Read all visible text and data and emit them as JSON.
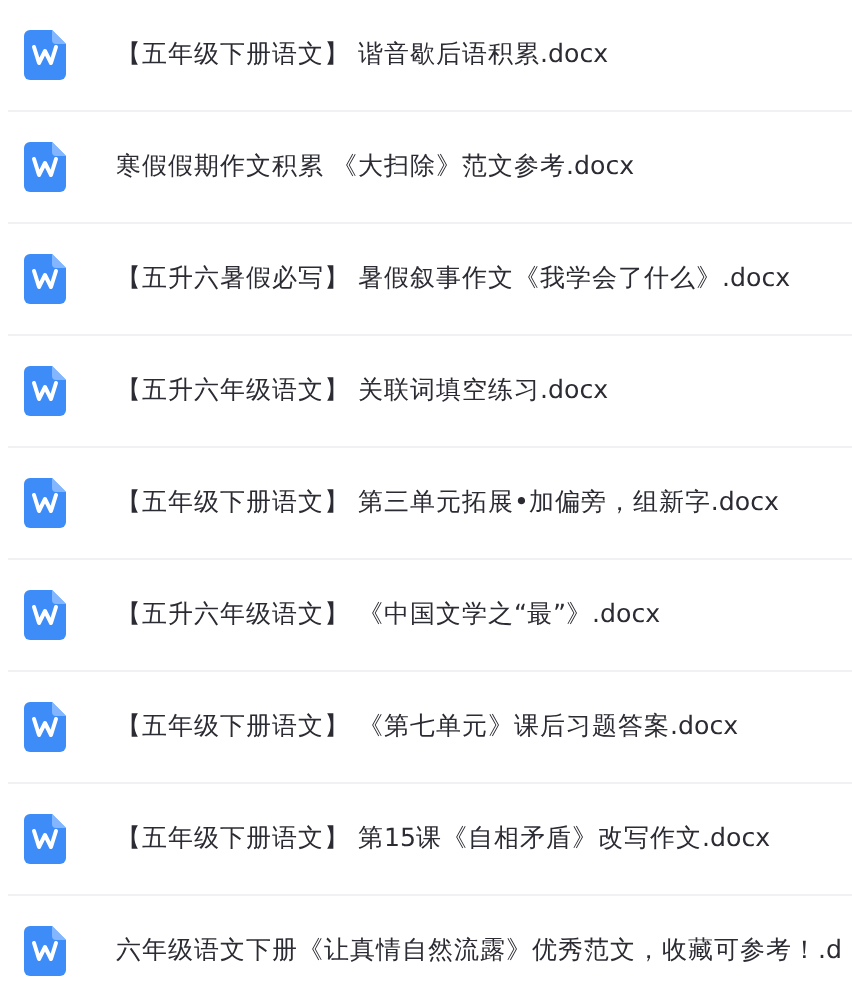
{
  "files": [
    {
      "name": "【五年级下册语文】 谐音歇后语积累.docx"
    },
    {
      "name": "寒假假期作文积累 《大扫除》范文参考.docx"
    },
    {
      "name": "【五升六暑假必写】 暑假叙事作文《我学会了什么》.docx"
    },
    {
      "name": "【五升六年级语文】 关联词填空练习.docx"
    },
    {
      "name": "【五年级下册语文】 第三单元拓展•加偏旁，组新字.docx"
    },
    {
      "name": "【五升六年级语文】 《中国文学之“最”》.docx"
    },
    {
      "name": "【五年级下册语文】 《第七单元》课后习题答案.docx"
    },
    {
      "name": "【五年级下册语文】 第15课《自相矛盾》改写作文.docx"
    },
    {
      "name": "六年级语文下册《让真情自然流露》优秀范文，收藏可参考！.d"
    }
  ]
}
